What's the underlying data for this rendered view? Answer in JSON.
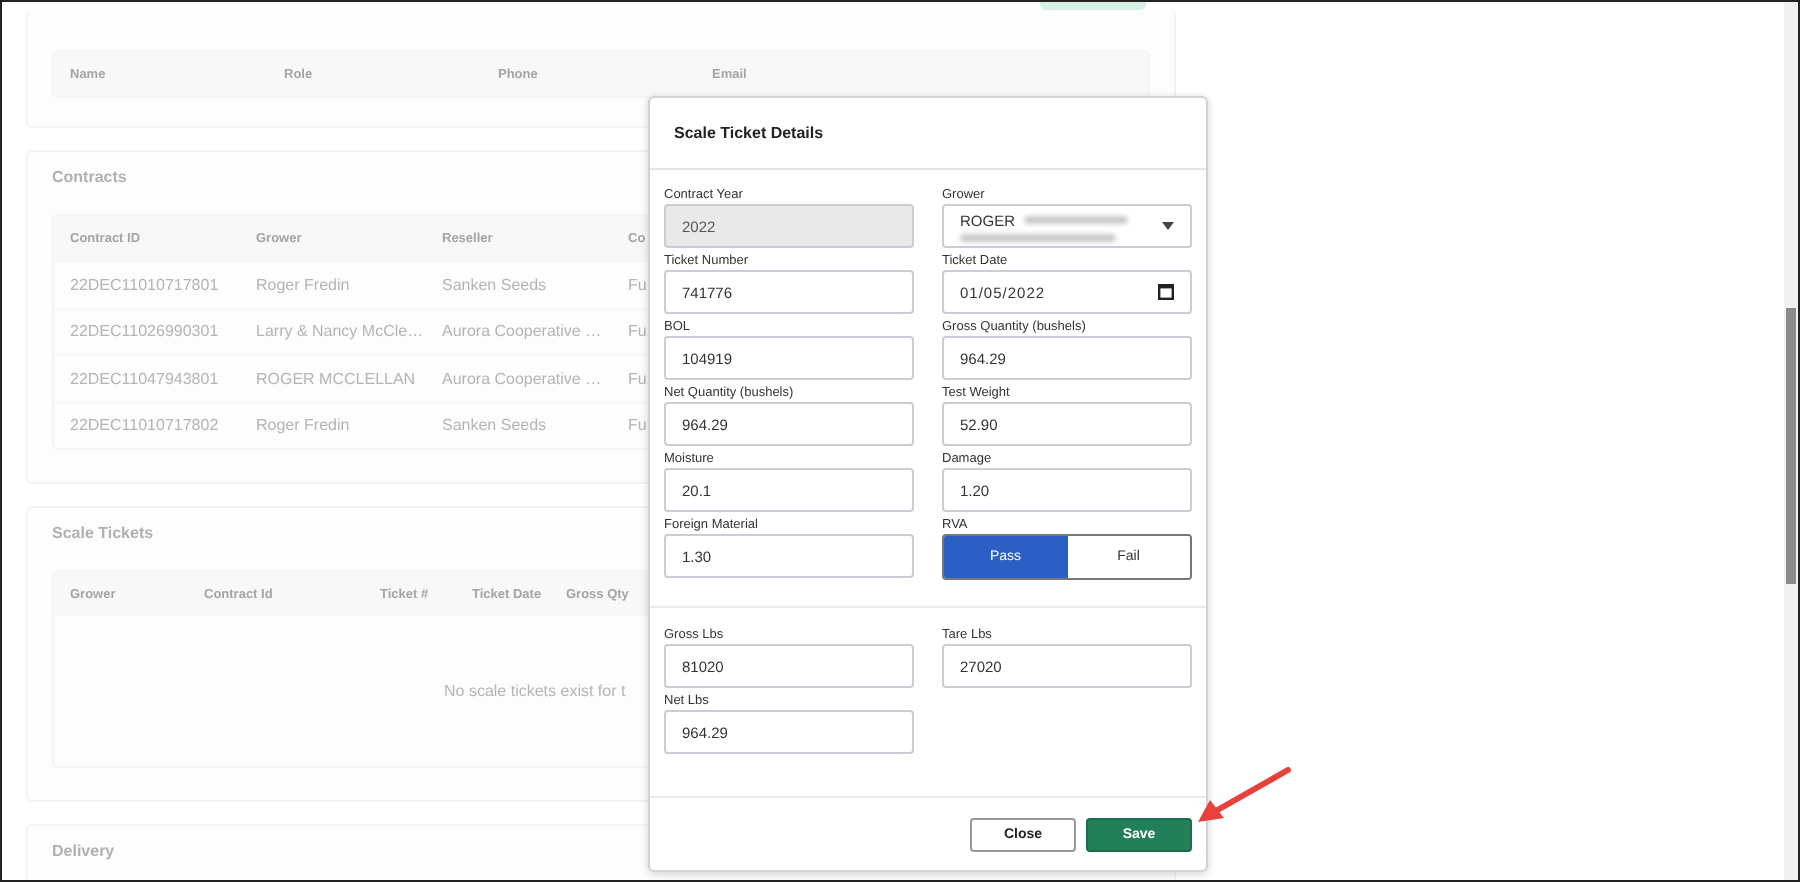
{
  "background": {
    "top_button": {
      "kind": "button"
    },
    "contacts": {
      "columns": [
        "Name",
        "Role",
        "Phone",
        "Email"
      ]
    },
    "contracts": {
      "title": "Contracts",
      "columns": [
        "Contract ID",
        "Grower",
        "Reseller",
        "Co"
      ],
      "rows": [
        [
          "22DEC11010717801",
          "Roger Fredin",
          "Sanken Seeds",
          "Fu"
        ],
        [
          "22DEC11026990301",
          "Larry & Nancy McCle…",
          "Aurora Cooperative …",
          "Fu"
        ],
        [
          "22DEC11047943801",
          "ROGER MCCLELLAN",
          "Aurora Cooperative …",
          "Fu"
        ],
        [
          "22DEC11010717802",
          "Roger Fredin",
          "Sanken Seeds",
          "Fu"
        ]
      ]
    },
    "scale_tickets": {
      "title": "Scale Tickets",
      "columns": [
        "Grower",
        "Contract Id",
        "Ticket #",
        "Ticket Date",
        "Gross Qty"
      ],
      "empty_message": "No scale tickets exist for t"
    },
    "delivery": {
      "title": "Delivery"
    }
  },
  "dialog": {
    "title": "Scale Ticket Details",
    "sections": [
      {
        "fields": [
          {
            "kind": "disabled",
            "label": "Contract Year",
            "value": "2022"
          },
          {
            "kind": "select",
            "label": "Grower",
            "value": "ROGER"
          },
          {
            "kind": "text",
            "label": "Ticket Number",
            "value": "741776"
          },
          {
            "kind": "date",
            "label": "Ticket Date",
            "value": "01/05/2022"
          },
          {
            "kind": "text",
            "label": "BOL",
            "value": "104919"
          },
          {
            "kind": "text",
            "label": "Gross Quantity (bushels)",
            "value": "964.29"
          },
          {
            "kind": "text",
            "label": "Net Quantity (bushels)",
            "value": "964.29"
          },
          {
            "kind": "text",
            "label": "Test Weight",
            "value": "52.90"
          },
          {
            "kind": "text",
            "label": "Moisture",
            "value": "20.1"
          },
          {
            "kind": "text",
            "label": "Damage",
            "value": "1.20"
          },
          {
            "kind": "text",
            "label": "Foreign Material",
            "value": "1.30"
          },
          {
            "kind": "toggle",
            "label": "RVA",
            "options": [
              {
                "label": "Pass",
                "selected": true
              },
              {
                "label": "Fail",
                "selected": false
              }
            ]
          }
        ]
      },
      {
        "fields": [
          {
            "kind": "text",
            "label": "Gross Lbs",
            "value": "81020"
          },
          {
            "kind": "text",
            "label": "Tare Lbs",
            "value": "27020"
          },
          {
            "kind": "text",
            "label": "Net Lbs",
            "value": "964.29"
          }
        ]
      }
    ],
    "buttons": [
      {
        "kind": "secondary",
        "label": "Close"
      },
      {
        "kind": "primary",
        "label": "Save"
      }
    ]
  }
}
